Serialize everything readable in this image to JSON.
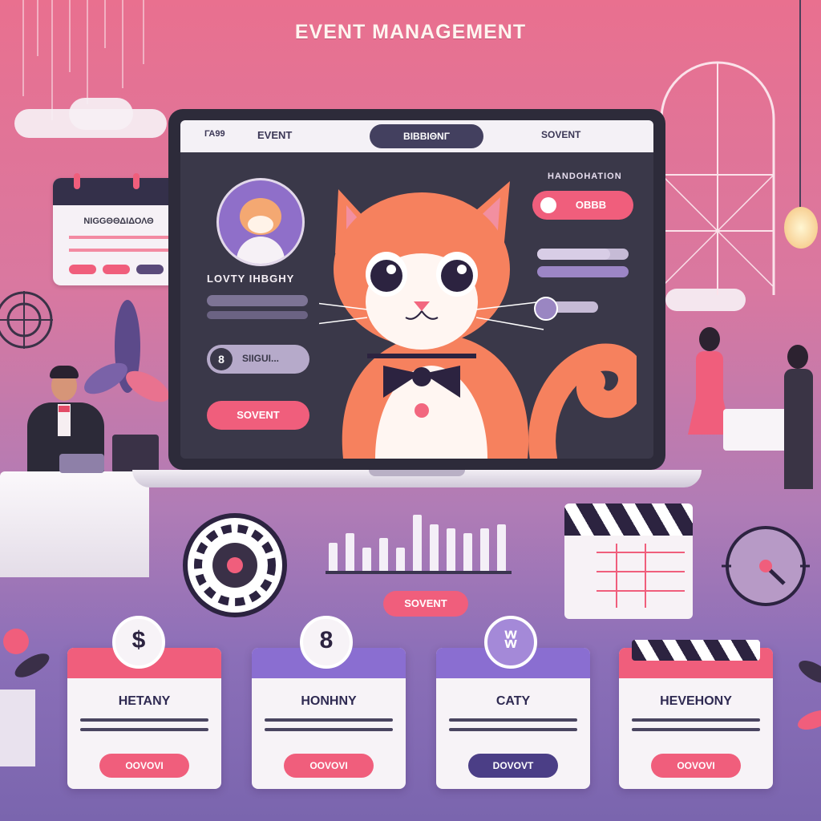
{
  "header": {
    "title": "EVENT MANAGEMENT"
  },
  "laptop": {
    "nav": {
      "left_label": "ΓΑ99",
      "event_label": "EVENT",
      "active_pill": "ΒΙΒΒΙΘΝΓ",
      "right_label": "SOVENT"
    },
    "profile": {
      "name": "LOVTY IHBGHY"
    },
    "toggle": {
      "knob": "8",
      "label": "SIIGUI..."
    },
    "primary_button": "SOVENT",
    "side_panel": {
      "label": "HANDOHATION",
      "pill_label": "OBBB"
    }
  },
  "calendar_widget": {
    "label": "NIGGΘΘΔΙΔΟΛΘ"
  },
  "chart_data": {
    "type": "bar",
    "categories": [
      "",
      "",
      "",
      "",
      "",
      "",
      "",
      "",
      "",
      "",
      ""
    ],
    "values": [
      6,
      8,
      5,
      7,
      5,
      12,
      10,
      9,
      8,
      9,
      10
    ],
    "title": "",
    "xlabel": "",
    "ylabel": ""
  },
  "chart_button": "SOVENT",
  "cards": [
    {
      "badge": "$",
      "title": "HETANY",
      "button": "OOVOVI",
      "accent": "#f05e7c",
      "button_color": "#f05e7c"
    },
    {
      "badge": "8",
      "title": "HONHNY",
      "button": "OOVOVI",
      "accent": "#8a6ed1",
      "button_color": "#f05e7c"
    },
    {
      "badge": "ʬ",
      "title": "CATY",
      "button": "DOVOVT",
      "accent": "#8a6ed1",
      "button_color": "#4b3e86"
    },
    {
      "badge": "",
      "title": "HEVEHONY",
      "button": "OOVOVI",
      "accent": "#f05e7c",
      "button_color": "#f05e7c"
    }
  ],
  "colors": {
    "pink": "#f05e7c",
    "dark": "#34304a",
    "purple": "#8a6ed1"
  }
}
